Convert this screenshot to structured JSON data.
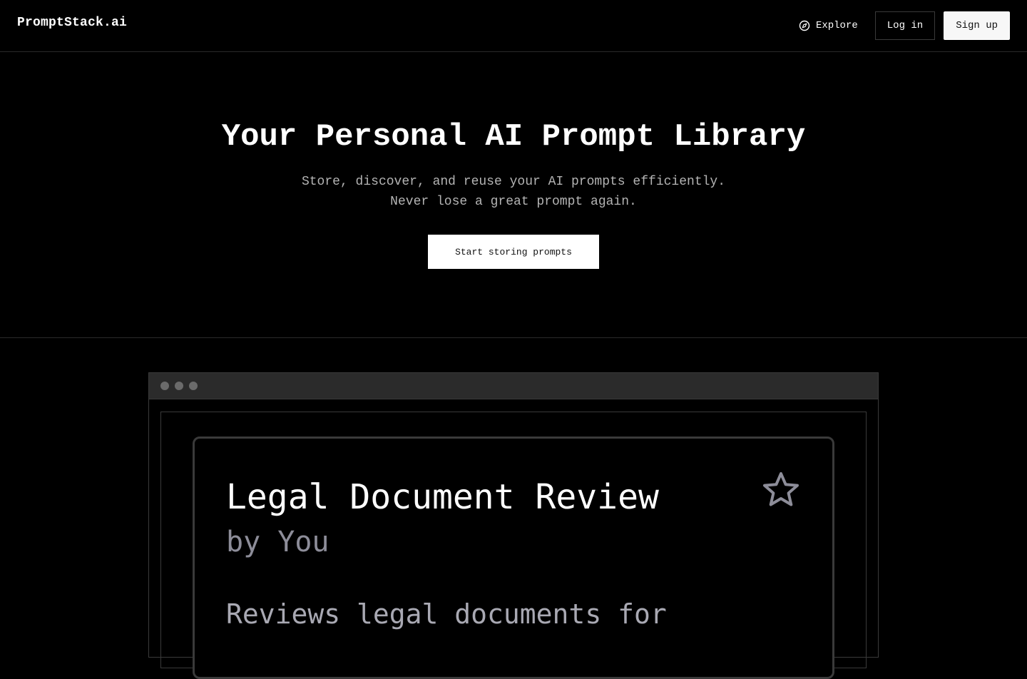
{
  "header": {
    "logo": "PromptStack.ai",
    "nav": {
      "explore_label": "Explore",
      "login_label": "Log in",
      "signup_label": "Sign up"
    }
  },
  "hero": {
    "title": "Your Personal AI Prompt Library",
    "subtitle_line1": "Store, discover, and reuse your AI prompts efficiently.",
    "subtitle_line2": "Never lose a great prompt again.",
    "cta_label": "Start storing prompts"
  },
  "preview": {
    "window_dots": [
      "#6b6b6b",
      "#6b6b6b",
      "#6b6b6b"
    ],
    "card": {
      "title": "Legal Document Review",
      "author": "by You",
      "description": "Reviews legal documents for",
      "favorite_icon": "star-icon"
    }
  },
  "colors": {
    "background": "#000000",
    "text": "#ffffff",
    "muted": "#b4b4b4",
    "border": "#3a3a3a"
  }
}
